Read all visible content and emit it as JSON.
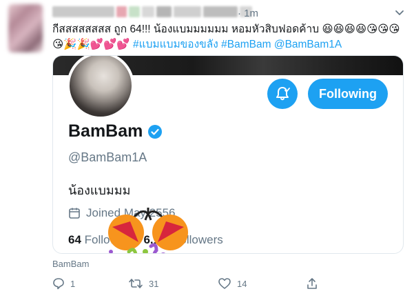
{
  "tweet": {
    "time": "1m",
    "text": "กีสสสสสสสส ถูก 64!!! น้องแบมมมมมม หอมหัวสิบฟอดค้าบ 😆😆😆😆😘😘😘😘🎉🎉💕💕💕",
    "hashtag": "#แบมแบมของขลัง",
    "hashtag2": "#BamBam",
    "mention": "@BamBam1A",
    "quoted_name": "BamBam"
  },
  "card": {
    "name": "BamBam",
    "handle": "@BamBam1A",
    "bio": "น้องแบมมม",
    "joined": "Joined May 2556",
    "following_count": "64",
    "following_label": "Following",
    "followers_count": "6.1M",
    "followers_label": "Followers",
    "follow_button": "Following"
  },
  "actions": {
    "reply_count": "1",
    "retweet_count": "31",
    "like_count": "14"
  },
  "colors": {
    "accent": "#1da1f2",
    "text": "#14171a",
    "muted": "#657786"
  }
}
